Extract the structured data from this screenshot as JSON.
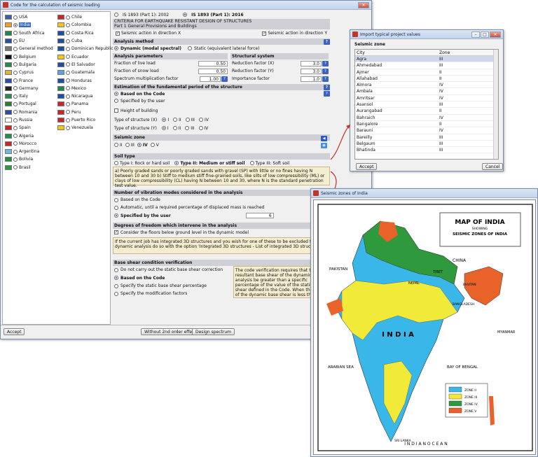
{
  "main_window": {
    "title": "Code for the calculation of seismic loading",
    "countries_col1": [
      {
        "name": "USA",
        "selected": false
      },
      {
        "name": "India",
        "selected": true
      },
      {
        "name": "South Africa",
        "selected": false
      },
      {
        "name": "EU",
        "selected": false
      },
      {
        "name": "General method",
        "selected": false
      },
      {
        "name": "Belgium",
        "selected": false
      },
      {
        "name": "Bulgaria",
        "selected": false
      },
      {
        "name": "Cyprus",
        "selected": false
      },
      {
        "name": "France",
        "selected": false
      },
      {
        "name": "Germany",
        "selected": false
      },
      {
        "name": "Italy",
        "selected": false
      },
      {
        "name": "Portugal",
        "selected": false
      },
      {
        "name": "Romania",
        "selected": false
      },
      {
        "name": "Russia",
        "selected": false
      },
      {
        "name": "Spain",
        "selected": false
      },
      {
        "name": "Algeria",
        "selected": false
      },
      {
        "name": "Morocco",
        "selected": false
      },
      {
        "name": "Argentina",
        "selected": false
      },
      {
        "name": "Bolivia",
        "selected": false
      },
      {
        "name": "Brasil",
        "selected": false
      }
    ],
    "countries_col2": [
      {
        "name": "Chile"
      },
      {
        "name": "Colombia"
      },
      {
        "name": "Costa Rica"
      },
      {
        "name": "Cuba"
      },
      {
        "name": "Dominican Republic"
      },
      {
        "name": "Ecuador"
      },
      {
        "name": "El Salvador"
      },
      {
        "name": "Guatemala"
      },
      {
        "name": "Honduras"
      },
      {
        "name": "Mexico"
      },
      {
        "name": "Nicaragua"
      },
      {
        "name": "Panama"
      },
      {
        "name": "Peru"
      },
      {
        "name": "Puerto Rico"
      },
      {
        "name": "Venezuela"
      }
    ],
    "code_options": [
      "IS 1893 (Part 1): 2002",
      "IS 1893 (Part 1): 2016"
    ],
    "code_selected": "IS 1893 (Part 1): 2016",
    "criteria_title": "CRITERIA FOR EARTHQUAKE RESISTANT DESIGN OF STRUCTURES",
    "criteria_sub": "Part 1 General Provisions and Buildings",
    "seismic_x": "Seismic action in direction X",
    "seismic_y": "Seismic action in direction Y",
    "analysis_method_hdr": "Analysis method",
    "analysis_dynamic": "Dynamic (modal spectral)",
    "analysis_static": "Static (equivalent lateral force)",
    "analysis_params_hdr": "Analysis parameters",
    "structural_system_hdr": "Structural system",
    "live_load_label": "Fraction of live load",
    "live_load_value": "0.50",
    "snow_load_label": "Fraction of snow load",
    "snow_load_value": "0.50",
    "spectrum_label": "Spectrum multiplication factor",
    "spectrum_value": "1.00",
    "rx_label": "Reduction factor (X)",
    "rx_value": "3.0",
    "ry_label": "Reduction factor (Y)",
    "ry_value": "3.0",
    "importance_label": "Importance factor",
    "importance_value": "1.0",
    "period_hdr": "Estimation of the fundamental period of the structure",
    "period_code": "Based on the Code",
    "period_user": "Specified by the user",
    "height_label": "Height of building",
    "type_x_label": "Type of structure (X)",
    "type_y_label": "Type of structure (Y)",
    "type_options": [
      "I",
      "II",
      "III",
      "IV"
    ],
    "seismic_zone_hdr": "Seismic zone",
    "zone_options": [
      "II",
      "III",
      "IV",
      "V"
    ],
    "zone_selected": "IV",
    "soil_hdr": "Soil type",
    "soil_options": [
      "Type I: Rock or hard soil",
      "Type II: Medium or stiff soil",
      "Type III: Soft soil"
    ],
    "soil_text": "a) Poorly graded sands or poorly graded sands with gravel (SP) with little or no fines having N between 10 and 30 b) Stiff to medium stiff fine-grained soils, like silts of low compressibility (ML) or clays of low compressibility (CL) having N between 10 and 30, where N is the standard penetration test value.",
    "vib_hdr": "Number of vibration modes considered in the analysis",
    "vib_code": "Based on the Code",
    "vib_auto": "Automatic, until a required percentage of displaced mass is reached",
    "vib_user": "Specified by the user",
    "vib_value": "6",
    "dof_hdr": "Degrees of freedom which intervene in the analysis",
    "dof_check": "Consider the floors below ground level in the dynamic model",
    "dof_text": "If the current job has integrated 3D structures and you wish for one of these to be excluded from the dynamic analysis do so with the option 'Integrated 3D structures - List of integrated 3D structures'.",
    "shear_hdr": "Base shear condition verification",
    "shear_opts": [
      "Do not carry out the static base shear correction",
      "Based on the Code",
      "Specify the static base shear percentage",
      "Specify the modification factors"
    ],
    "shear_text": "The code verification requires that the resultant base shear of the dynamic analysis be greater than a specific percentage of the value of the static base shear defined in the Code. When the value of the dynamic base shear is less than the minimum prescribed by the Code, the program adjusts the results by applying the corresponding modification factor.",
    "accept": "Accept",
    "btn_2nd_order": "Without 2nd order effects",
    "btn_spectrum": "Design spectrum"
  },
  "zone_dialog": {
    "title": "Import typical project values",
    "section": "Seismic zone",
    "col_city": "City",
    "col_zone": "Zone",
    "rows": [
      [
        "Agra",
        "III"
      ],
      [
        "Ahmedabad",
        "III"
      ],
      [
        "Ajmer",
        "II"
      ],
      [
        "Allahabad",
        "II"
      ],
      [
        "Almora",
        "IV"
      ],
      [
        "Ambala",
        "IV"
      ],
      [
        "Amritsar",
        "IV"
      ],
      [
        "Asansol",
        "III"
      ],
      [
        "Aurangabad",
        "II"
      ],
      [
        "Bahraich",
        "IV"
      ],
      [
        "Bangalore",
        "II"
      ],
      [
        "Barauni",
        "IV"
      ],
      [
        "Bareilly",
        "III"
      ],
      [
        "Belgaum",
        "III"
      ],
      [
        "Bhatinda",
        "III"
      ]
    ],
    "accept": "Accept",
    "cancel": "Cancel"
  },
  "map_window": {
    "title": "Seismic zones of India",
    "map_title": "MAP OF INDIA",
    "map_showing": "SHOWING",
    "map_subtitle": "SEISMIC ZONES OF INDIA",
    "legend": [
      {
        "label": "ZONE II",
        "color": "#39b7e8"
      },
      {
        "label": "ZONE III",
        "color": "#f2ea38"
      },
      {
        "label": "ZONE IV",
        "color": "#2f9a3d"
      },
      {
        "label": "ZONE V",
        "color": "#e8622a"
      }
    ],
    "labels": {
      "china": "CHINA",
      "tibet": "TIBET",
      "pakistan": "PAKISTAN",
      "nepal": "NEPAL",
      "bhutan": "BHUTAN",
      "bangladesh": "BANGLADESH",
      "myanmar": "MYANMAR",
      "arabian_sea": "ARABIAN SEA",
      "bay": "BAY OF BENGAL",
      "srilanka": "SRI LANKA",
      "ocean": "I N D I A N   O C E A N",
      "india": "I N D I A"
    }
  },
  "colors": {
    "accent": "#3169c6",
    "arrow": "#d22a2a"
  }
}
